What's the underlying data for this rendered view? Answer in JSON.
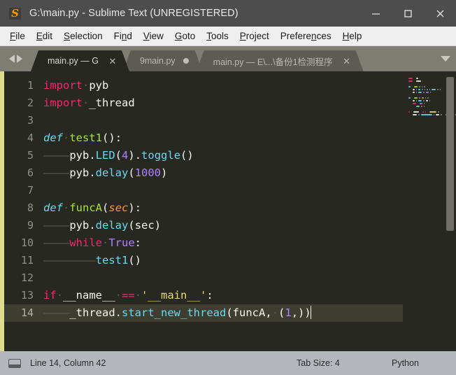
{
  "window": {
    "title": "G:\\main.py - Sublime Text (UNREGISTERED)",
    "logo_letter": "S",
    "minimize_label": "–",
    "maximize_label": "□",
    "close_label": "✕"
  },
  "menubar": {
    "items": [
      {
        "pre": "",
        "accel": "F",
        "post": "ile"
      },
      {
        "pre": "",
        "accel": "E",
        "post": "dit"
      },
      {
        "pre": "",
        "accel": "S",
        "post": "election"
      },
      {
        "pre": "Fi",
        "accel": "n",
        "post": "d"
      },
      {
        "pre": "",
        "accel": "V",
        "post": "iew"
      },
      {
        "pre": "",
        "accel": "G",
        "post": "oto"
      },
      {
        "pre": "",
        "accel": "T",
        "post": "ools"
      },
      {
        "pre": "",
        "accel": "P",
        "post": "roject"
      },
      {
        "pre": "Prefere",
        "accel": "n",
        "post": "ces"
      },
      {
        "pre": "",
        "accel": "H",
        "post": "elp"
      }
    ]
  },
  "tabbar": {
    "prev_arrow": "prev-tab-arrow",
    "next_arrow": "next-tab-arrow",
    "dropdown": "tab-list-dropdown",
    "tabs": [
      {
        "label": "main.py — G",
        "active": true,
        "dirty": false,
        "close": "✕"
      },
      {
        "label": "9main.py",
        "active": false,
        "dirty": true,
        "close": ""
      },
      {
        "label": "main.py — E\\...\\备份1检测程序",
        "active": false,
        "dirty": false,
        "close": "✕"
      }
    ]
  },
  "editor": {
    "current_line": 14,
    "lines": [
      {
        "n": "1",
        "text": "import pyb"
      },
      {
        "n": "2",
        "text": "import _thread"
      },
      {
        "n": "3",
        "text": ""
      },
      {
        "n": "4",
        "text": "def test1():"
      },
      {
        "n": "5",
        "text": "\tpyb.LED(4).toggle()"
      },
      {
        "n": "6",
        "text": "\tpyb.delay(1000)"
      },
      {
        "n": "7",
        "text": ""
      },
      {
        "n": "8",
        "text": "def funcA(sec):"
      },
      {
        "n": "9",
        "text": "\tpyb.delay(sec)"
      },
      {
        "n": "10",
        "text": "\twhile True:"
      },
      {
        "n": "11",
        "text": "\t\ttest1()"
      },
      {
        "n": "12",
        "text": ""
      },
      {
        "n": "13",
        "text": "if __name__ == '__main__':"
      },
      {
        "n": "14",
        "text": "\t_thread.start_new_thread(funcA, (1,))"
      }
    ]
  },
  "statusbar": {
    "sidebar_icon": "sidebar-toggle-icon",
    "position": "Line 14, Column 42",
    "tab_size": "Tab Size: 4",
    "syntax": "Python"
  },
  "colors": {
    "accent_orange": "#ff9800",
    "editor_bg": "#272822",
    "keyword": "#f92672",
    "function": "#a6e22e",
    "string": "#e6db74",
    "number": "#ae81ff",
    "type": "#66d9ef",
    "left_edge": "#dcdc8c"
  }
}
